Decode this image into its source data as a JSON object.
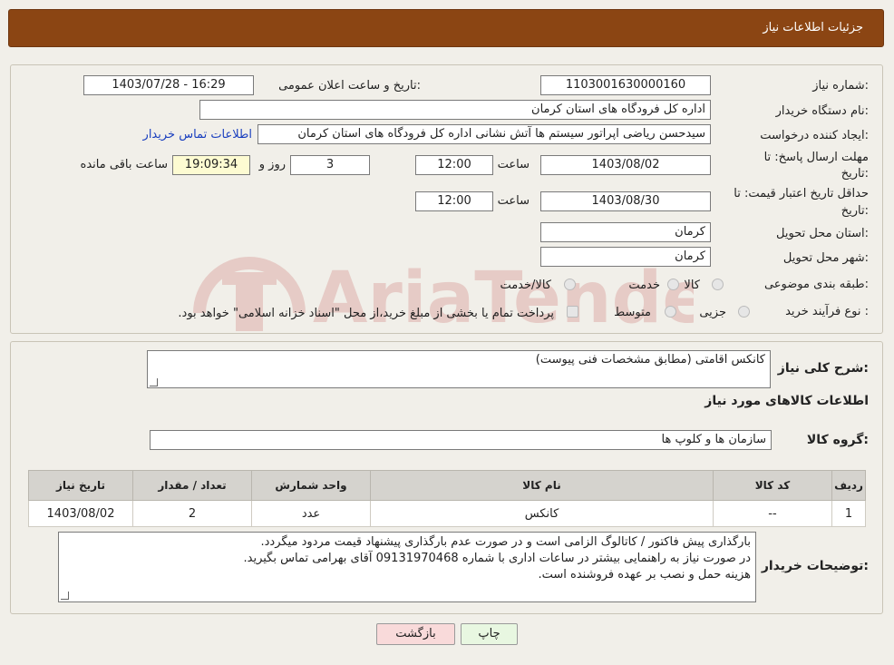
{
  "header": {
    "title": "جزئیات اطلاعات نیاز"
  },
  "fields": {
    "need_number_label": "شماره نیاز:",
    "need_number": "1103001630000160",
    "announce_label": "تاریخ و ساعت اعلان عمومی:",
    "announce_value": "1403/07/28 - 16:29",
    "buyer_org_label": "نام دستگاه خریدار:",
    "buyer_org": "اداره کل فرودگاه های استان کرمان",
    "requester_label": "ایجاد کننده درخواست:",
    "requester": "سیدحسن ریاضی اپراتور سیستم ها آتش نشانی اداره کل فرودگاه های استان کرمان",
    "contact_link": "اطلاعات تماس خریدار",
    "deadline_label_1": "مهلت ارسال پاسخ: تا",
    "deadline_label_2": "تاریخ:",
    "deadline_date": "1403/08/02",
    "time_label": "ساعت",
    "deadline_time": "12:00",
    "days_value": "3",
    "days_label": "روز و",
    "remaining_time": "19:09:34",
    "remaining_label": "ساعت باقی مانده",
    "validity_label_1": "حداقل تاریخ اعتبار قیمت: تا",
    "validity_label_2": "تاریخ:",
    "validity_date": "1403/08/30",
    "validity_time": "12:00",
    "province_label": "استان محل تحویل:",
    "province": "کرمان",
    "city_label": "شهر محل تحویل:",
    "city": "کرمان",
    "category_label": "طبقه بندی موضوعی:",
    "category_options": [
      "کالا",
      "خدمت",
      "کالا/خدمت"
    ],
    "process_label": "نوع فرآیند خرید :",
    "process_options": [
      "جزیی",
      "متوسط"
    ],
    "process_note": "پرداخت تمام یا بخشی از مبلغ خرید،از محل \"اسناد خزانه اسلامی\" خواهد بود."
  },
  "summary": {
    "general_desc_label": "شرح کلی نیاز:",
    "general_desc": "کانکس اقامتی (مطابق مشخصات فنی پیوست)",
    "goods_info_title": "اطلاعات کالاهای مورد نیاز",
    "goods_group_label": "گروه کالا:",
    "goods_group": "سازمان ها و کلوپ ها"
  },
  "table": {
    "headers": [
      "ردیف",
      "کد کالا",
      "نام کالا",
      "واحد شمارش",
      "تعداد / مقدار",
      "تاریخ نیاز"
    ],
    "rows": [
      [
        "1",
        "--",
        "کانکس",
        "عدد",
        "2",
        "1403/08/02"
      ]
    ]
  },
  "buyer_notes": {
    "label": "توضیحات خریدار:",
    "lines": [
      "بارگذاری پیش فاکتور / کاتالوگ الزامی است و در صورت عدم بارگذاری پیشنهاد قیمت مردود میگردد.",
      "در صورت نیاز به راهنمایی بیشتر در ساعات اداری با شماره 09131970468 آقای بهرامی تماس بگیرید.",
      "هزینه حمل و نصب بر عهده فروشنده است."
    ]
  },
  "buttons": {
    "print": "چاپ",
    "back": "بازگشت"
  },
  "watermark": {
    "text": "AriaTender.neT"
  },
  "colors": {
    "header_bg": "#8b4513",
    "print_btn": "#e8f7e1",
    "back_btn": "#f9dada",
    "link": "#1a3fbf",
    "watermark": "#b22222"
  }
}
